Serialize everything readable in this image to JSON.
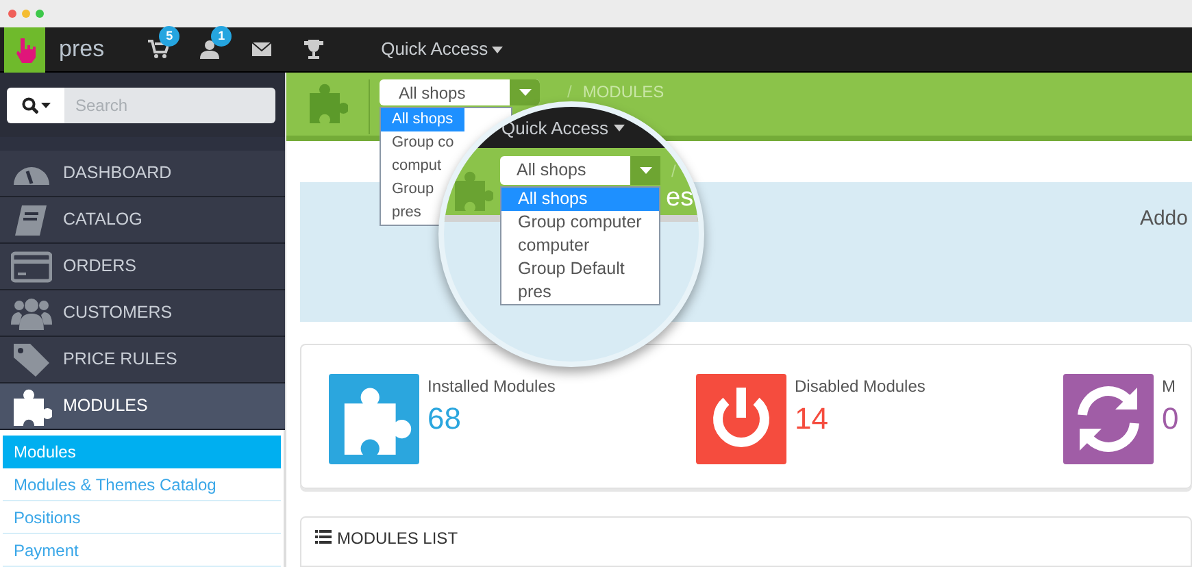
{
  "top_bar": {
    "shop_name": "pres",
    "badges": [
      {
        "kind": "cart",
        "count": "5"
      },
      {
        "kind": "user",
        "count": "1"
      },
      {
        "kind": "mail"
      },
      {
        "kind": "trophy"
      }
    ],
    "quick_access": "Quick Access"
  },
  "search": {
    "placeholder": "Search"
  },
  "sidebar": {
    "items": [
      {
        "kind": "dashboard",
        "label": "DASHBOARD",
        "selected": false
      },
      {
        "kind": "catalog",
        "label": "CATALOG",
        "selected": false
      },
      {
        "kind": "orders",
        "label": "ORDERS",
        "selected": false
      },
      {
        "kind": "customers",
        "label": "CUSTOMERS",
        "selected": false
      },
      {
        "kind": "price",
        "label": "PRICE RULES",
        "selected": false
      },
      {
        "kind": "modules",
        "label": "MODULES",
        "selected": true
      }
    ],
    "submenu": [
      {
        "label": "Modules",
        "selected": true
      },
      {
        "label": "Modules & Themes Catalog",
        "selected": false
      },
      {
        "label": "Positions",
        "selected": false
      },
      {
        "label": "Payment",
        "selected": false
      }
    ]
  },
  "header": {
    "shop_select": "All shops",
    "options": [
      {
        "label": "All shops",
        "selected": true
      },
      {
        "label": "Group co",
        "selected": false
      },
      {
        "label": "comput",
        "selected": false
      },
      {
        "label": "Group",
        "selected": false
      },
      {
        "label": "pres",
        "selected": false
      }
    ],
    "breadcrumb_separator": "/",
    "breadcrumb": "MODULES"
  },
  "magnifier": {
    "quick_access": "Quick Access",
    "shop_select": "All shops",
    "options": [
      {
        "label": "All shops",
        "selected": true
      },
      {
        "label": "Group computer",
        "selected": false
      },
      {
        "label": "computer",
        "selected": false
      },
      {
        "label": "Group Default",
        "selected": false
      },
      {
        "label": "pres",
        "selected": false
      }
    ],
    "breadcrumb_separator": "/",
    "title_fragment": "es"
  },
  "banner": {
    "text": "Addo"
  },
  "stats": [
    {
      "kind": "installed",
      "label": "Installed Modules",
      "value": "68",
      "color": "#2ba6de"
    },
    {
      "kind": "disabled",
      "label": "Disabled Modules",
      "value": "14",
      "color": "#f54c3e"
    },
    {
      "kind": "updates",
      "label": "M",
      "value": "0",
      "color": "#a05da6"
    }
  ],
  "modules_list": {
    "title": "MODULES LIST"
  }
}
